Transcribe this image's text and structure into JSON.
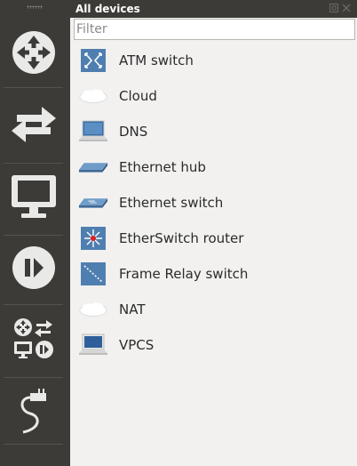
{
  "dock": {
    "title": "All devices",
    "filter_placeholder": "Filter"
  },
  "toolbar": {
    "buttons": [
      {
        "name": "browse-routers",
        "icon": "router-icon"
      },
      {
        "name": "browse-switches",
        "icon": "switch-arrows-icon"
      },
      {
        "name": "browse-end-devices",
        "icon": "monitor-icon"
      },
      {
        "name": "browse-security-devices",
        "icon": "security-device-icon"
      },
      {
        "name": "browse-all-devices",
        "icon": "all-devices-icon"
      },
      {
        "name": "add-link",
        "icon": "cable-link-icon"
      }
    ]
  },
  "devices": [
    {
      "label": "ATM switch",
      "icon": "atm-switch-icon"
    },
    {
      "label": "Cloud",
      "icon": "cloud-icon"
    },
    {
      "label": "DNS",
      "icon": "laptop-icon"
    },
    {
      "label": "Ethernet hub",
      "icon": "ethernet-hub-icon"
    },
    {
      "label": "Ethernet switch",
      "icon": "ethernet-switch-icon"
    },
    {
      "label": "EtherSwitch router",
      "icon": "etherswitch-router-icon"
    },
    {
      "label": "Frame Relay switch",
      "icon": "frame-relay-switch-icon"
    },
    {
      "label": "NAT",
      "icon": "cloud-icon"
    },
    {
      "label": "VPCS",
      "icon": "vpcs-icon"
    }
  ],
  "colors": {
    "toolbar_bg": "#3c3b37",
    "dock_bg": "#f2f1f0",
    "device_blue": "#4f7fb0"
  }
}
